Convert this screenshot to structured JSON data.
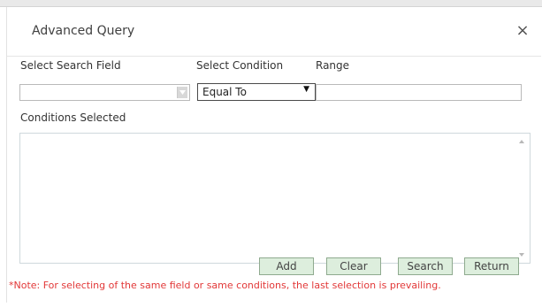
{
  "dialog": {
    "title": "Advanced Query",
    "close_glyph": "×"
  },
  "form": {
    "search_field_label": "Select Search Field",
    "search_field_value": "",
    "condition_label": "Select Condition",
    "condition_value": "Equal To",
    "range_label": "Range",
    "range_value": "",
    "conditions_selected_label": "Conditions Selected",
    "conditions_selected_value": ""
  },
  "buttons": {
    "add": "Add",
    "clear": "Clear",
    "search": "Search",
    "return": "Return"
  },
  "note": "*Note: For selecting of the same field or same conditions, the last selection is prevailing.",
  "colors": {
    "button_bg": "#ddeedd",
    "button_border": "#8faa8f",
    "note_color": "#e23838"
  },
  "icons": {
    "close": "close-icon",
    "dropdown": "chevron-down-icon",
    "scroll_up": "scroll-up-arrow-icon",
    "scroll_down": "scroll-down-arrow-icon"
  }
}
